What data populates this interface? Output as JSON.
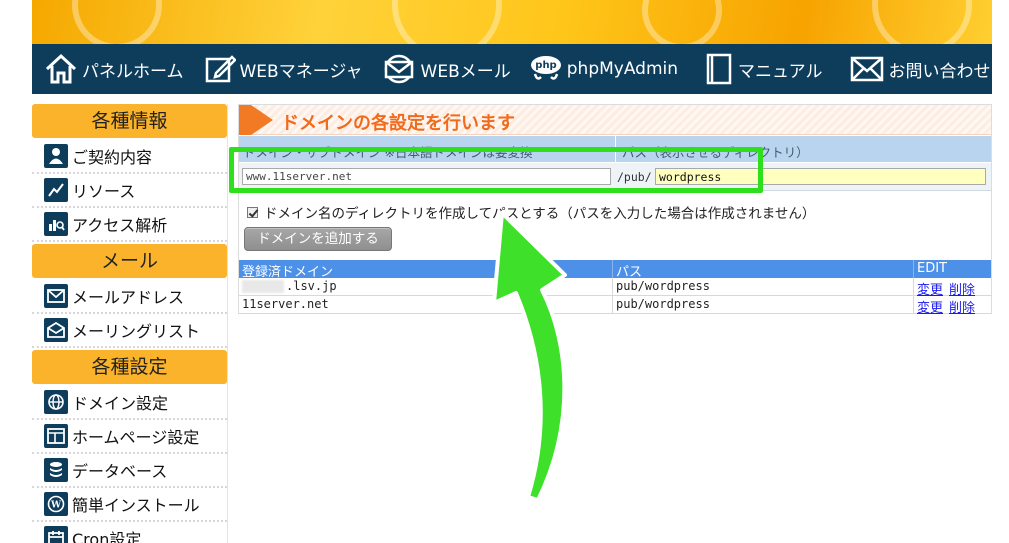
{
  "nav": {
    "items": [
      {
        "label": "パネルホーム",
        "icon": "home-icon"
      },
      {
        "label": "WEBマネージャ",
        "icon": "edit-icon"
      },
      {
        "label": "WEBメール",
        "icon": "mail-globe-icon"
      },
      {
        "label": "phpMyAdmin",
        "icon": "php-icon"
      },
      {
        "label": "マニュアル",
        "icon": "book-icon"
      },
      {
        "label": "お問い合わせ",
        "icon": "envelope-icon"
      }
    ]
  },
  "sidebar": {
    "sections": [
      {
        "title": "各種情報",
        "items": [
          {
            "label": "ご契約内容",
            "icon": "user-icon"
          },
          {
            "label": "リソース",
            "icon": "chart-line-icon"
          },
          {
            "label": "アクセス解析",
            "icon": "analytics-icon"
          }
        ]
      },
      {
        "title": "メール",
        "items": [
          {
            "label": "メールアドレス",
            "icon": "mail-icon"
          },
          {
            "label": "メーリングリスト",
            "icon": "mailing-list-icon"
          }
        ]
      },
      {
        "title": "各種設定",
        "items": [
          {
            "label": "ドメイン設定",
            "icon": "globe-icon"
          },
          {
            "label": "ホームページ設定",
            "icon": "webpage-icon"
          },
          {
            "label": "データベース",
            "icon": "database-icon"
          },
          {
            "label": "簡単インストール",
            "icon": "wordpress-icon"
          },
          {
            "label": "Cron設定",
            "icon": "calendar-icon"
          }
        ]
      }
    ]
  },
  "main": {
    "title": "ドメインの各設定を行います",
    "form": {
      "domain_header": "ドメイン・サブドメイン ※日本語ドメインは要変換",
      "path_header": "パス（表示させるディレクトリ）",
      "domain_value": "www.11server.net",
      "path_prefix": "/pub/",
      "path_value": "wordpress",
      "checkbox_label": "ドメイン名のディレクトリを作成してパスとする（パスを入力した場合は作成されません）",
      "checkbox_checked": true,
      "add_button": "ドメインを追加する"
    },
    "table": {
      "headers": [
        "登録済ドメイン",
        "パス",
        "EDIT"
      ],
      "rows": [
        {
          "domain": ".lsv.jp",
          "path": "pub/wordpress",
          "edit": "変更",
          "delete": "削除"
        },
        {
          "domain": "11server.net",
          "path": "pub/wordpress",
          "edit": "変更",
          "delete": "削除"
        }
      ]
    }
  },
  "colors": {
    "nav_bg": "#0e3d5c",
    "sidebar_head": "#fbb32b",
    "title_orange": "#f26a1b",
    "table_header": "#4d90e8",
    "highlight_green": "#2ee01c"
  }
}
